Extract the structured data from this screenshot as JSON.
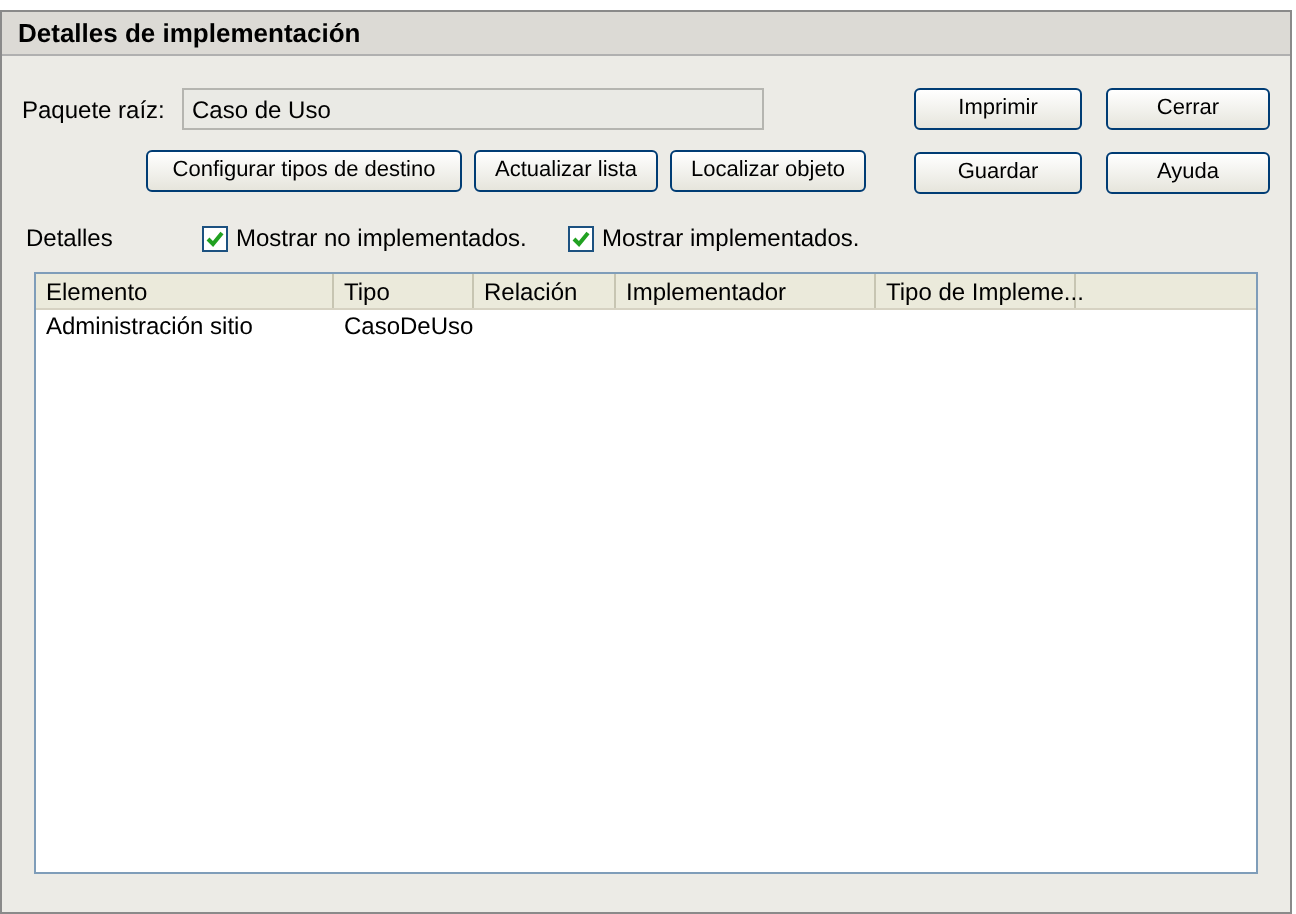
{
  "window": {
    "title": "Detalles de implementación"
  },
  "root_package": {
    "label": "Paquete raíz:",
    "value": "Caso de Uso"
  },
  "action_buttons": [
    "Configurar tipos de destino",
    "Actualizar lista",
    "Localizar objeto"
  ],
  "side_buttons": [
    "Imprimir",
    "Cerrar",
    "Guardar",
    "Ayuda"
  ],
  "details": {
    "label": "Detalles",
    "options": [
      {
        "label": "Mostrar no implementados.",
        "checked": true
      },
      {
        "label": "Mostrar implementados.",
        "checked": true
      }
    ]
  },
  "table": {
    "columns": [
      "Elemento",
      "Tipo",
      "Relación",
      "Implementador",
      "Tipo de Impleme..."
    ],
    "rows": [
      [
        "Administración sitio",
        "CasoDeUso",
        "",
        "",
        ""
      ]
    ]
  }
}
